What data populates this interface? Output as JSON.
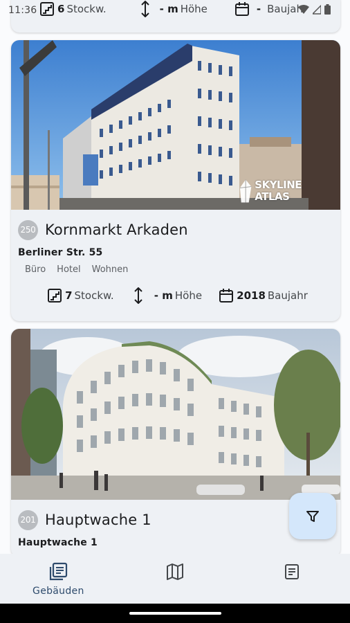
{
  "status_bar": {
    "time": "11:36"
  },
  "buildings": [
    {
      "floors_value": "6",
      "floors_unit": "Stockw.",
      "height_value": "- m",
      "height_unit": "Höhe",
      "year_value": "-",
      "year_unit": "Baujahr"
    },
    {
      "rank": "250",
      "name": "Kornmarkt Arkaden",
      "address": "Berliner Str. 55",
      "tags": [
        "Büro",
        "Hotel",
        "Wohnen"
      ],
      "image_watermark": [
        "SKYLINE",
        "ATLAS"
      ],
      "floors_value": "7",
      "floors_unit": "Stockw.",
      "height_value": "- m",
      "height_unit": "Höhe",
      "year_value": "2018",
      "year_unit": "Baujahr"
    },
    {
      "rank": "201",
      "name": "Hauptwache 1",
      "address": "Hauptwache 1"
    }
  ],
  "fab": {
    "icon": "filter-icon"
  },
  "nav": [
    {
      "label": "Gebäuden",
      "icon": "list-icon",
      "active": true
    },
    {
      "label": "",
      "icon": "map-icon",
      "active": false
    },
    {
      "label": "",
      "icon": "document-icon",
      "active": false
    }
  ],
  "colors": {
    "accent": "#2e4b6c",
    "card_bg": "#eef1f5",
    "fab_bg": "#d4e7fb",
    "badge": "#b9bcc0"
  }
}
